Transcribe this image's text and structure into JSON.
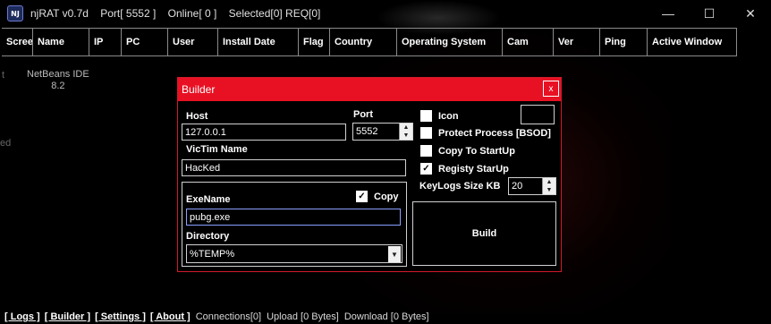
{
  "window": {
    "title": "njRAT v0.7d    Port[ 5552 ]    Online[ 0 ]    Selected[0] REQ[0]",
    "icon": "njrat-logo-icon",
    "icon_text": "NJ",
    "controls": {
      "minimize": "—",
      "maximize": "☐",
      "close": "✕"
    }
  },
  "columns": [
    "Scree",
    "Name",
    "IP",
    "PC",
    "User",
    "Install Date",
    "Flag",
    "Country",
    "Operating System",
    "Cam",
    "Ver",
    "Ping",
    "Active Window"
  ],
  "background_list": {
    "item_name": "NetBeans IDE",
    "item_version": "8.2",
    "edge_left_1": "t",
    "edge_left_2": "ed"
  },
  "builder": {
    "title": "Builder",
    "close_label": "x",
    "host_label": "Host",
    "host_value": "127.0.0.1",
    "port_label": "Port",
    "port_value": "5552",
    "victim_label": "VicTim Name",
    "victim_value": "HacKed",
    "exename_label": "ExeName",
    "exename_value": "pubg.exe",
    "copy_label": "Copy",
    "copy_checked": true,
    "directory_label": "Directory",
    "directory_value": "%TEMP%",
    "options": [
      {
        "label": "Icon",
        "checked": false
      },
      {
        "label": "Protect Process [BSOD]",
        "checked": false
      },
      {
        "label": "Copy To StartUp",
        "checked": false
      },
      {
        "label": "Registy StarUp",
        "checked": true
      }
    ],
    "keylogs_label": "KeyLogs Size KB",
    "keylogs_value": "20",
    "build_label": "Build"
  },
  "statusbar": {
    "logs": "[ Logs ]",
    "builder": "[ Builder ]",
    "settings": "[ Settings ]",
    "about": "[ About ]",
    "connections": "Connections[0]",
    "upload": "Upload [0 Bytes]",
    "download": "Download [0 Bytes]"
  },
  "colors": {
    "accent": "#e81123",
    "background": "#000000"
  }
}
